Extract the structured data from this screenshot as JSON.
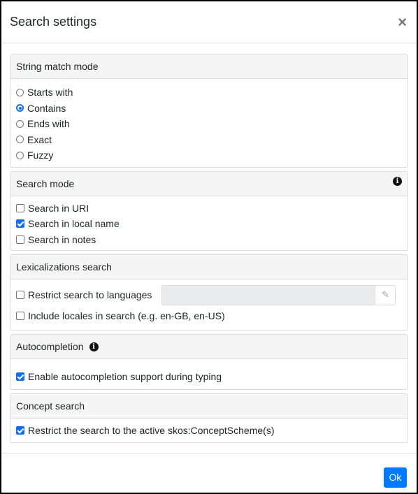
{
  "header": {
    "title": "Search settings",
    "close_icon": "×"
  },
  "string_match": {
    "title": "String match mode",
    "options": [
      {
        "label": "Starts with",
        "checked": false
      },
      {
        "label": "Contains",
        "checked": true
      },
      {
        "label": "Ends with",
        "checked": false
      },
      {
        "label": "Exact",
        "checked": false
      },
      {
        "label": "Fuzzy",
        "checked": false
      }
    ]
  },
  "search_mode": {
    "title": "Search mode",
    "info_icon": "i",
    "options": [
      {
        "label": "Search in URI",
        "checked": false
      },
      {
        "label": "Search in local name",
        "checked": true
      },
      {
        "label": "Search in notes",
        "checked": false
      }
    ]
  },
  "lexicalizations": {
    "title": "Lexicalizations search",
    "restrict_label": "Restrict search to languages",
    "restrict_checked": false,
    "languages_value": "",
    "edit_icon": "✎",
    "include_locales_label": "Include locales in search (e.g. en-GB, en-US)",
    "include_locales_checked": false
  },
  "autocompletion": {
    "title": "Autocompletion",
    "info_icon": "i",
    "enable_label": "Enable autocompletion support during typing",
    "enable_checked": true
  },
  "concept_search": {
    "title": "Concept search",
    "restrict_label": "Restrict the search to the active skos:ConceptScheme(s)",
    "restrict_checked": true
  },
  "footer": {
    "ok_label": "Ok"
  }
}
